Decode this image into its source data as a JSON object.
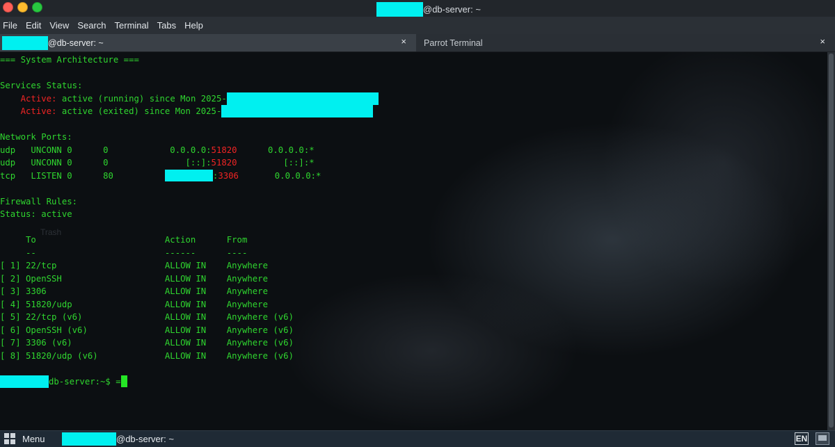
{
  "window": {
    "title_suffix": "@db-server: ~"
  },
  "menubar": [
    "File",
    "Edit",
    "View",
    "Search",
    "Terminal",
    "Tabs",
    "Help"
  ],
  "tabs": [
    {
      "label": "@db-server: ~",
      "close": "×"
    },
    {
      "label": "Parrot Terminal",
      "close": "×"
    }
  ],
  "terminal": {
    "lines": [
      {
        "parts": [
          {
            "t": "=== System Architecture ==="
          }
        ]
      },
      {
        "parts": [
          {
            "t": ""
          }
        ]
      },
      {
        "parts": [
          {
            "t": "Services Status:"
          }
        ]
      },
      {
        "parts": [
          {
            "t": "    "
          },
          {
            "t": "Active:",
            "c": "r"
          },
          {
            "t": " active (running) since Mon 2025-"
          }
        ],
        "redact": 218
      },
      {
        "parts": [
          {
            "t": "    "
          },
          {
            "t": "Active:",
            "c": "r"
          },
          {
            "t": " active (exited) since Mon 2025-"
          }
        ],
        "redact": 218
      },
      {
        "parts": [
          {
            "t": ""
          }
        ]
      },
      {
        "parts": [
          {
            "t": "Network Ports:"
          }
        ]
      },
      {
        "parts": [
          {
            "t": "udp   UNCONN 0      0            0.0.0.0:"
          },
          {
            "t": "51820",
            "c": "r"
          },
          {
            "t": "      0.0.0.0:*"
          }
        ]
      },
      {
        "parts": [
          {
            "t": "udp   UNCONN 0      0               [::]:"
          },
          {
            "t": "51820",
            "c": "r"
          },
          {
            "t": "         [::]:*"
          }
        ]
      },
      {
        "parts": [
          {
            "t": "tcp   LISTEN 0      80          "
          },
          {
            "t": ":"
          },
          {
            "t": "3306",
            "c": "r"
          },
          {
            "t": "       0.0.0.0:*"
          }
        ],
        "inline_redact": 69
      },
      {
        "parts": [
          {
            "t": ""
          }
        ]
      },
      {
        "parts": [
          {
            "t": "Firewall Rules:"
          }
        ]
      },
      {
        "parts": [
          {
            "t": "Status: active"
          }
        ]
      },
      {
        "parts": [
          {
            "t": ""
          }
        ]
      },
      {
        "parts": [
          {
            "t": "     To                         Action      From"
          }
        ]
      },
      {
        "parts": [
          {
            "t": "     --                         ------      ----"
          }
        ]
      },
      {
        "parts": [
          {
            "t": "[ 1] 22/tcp                     ALLOW IN    Anywhere"
          }
        ]
      },
      {
        "parts": [
          {
            "t": "[ 2] OpenSSH                    ALLOW IN    Anywhere"
          }
        ]
      },
      {
        "parts": [
          {
            "t": "[ 3] 3306                       ALLOW IN    Anywhere"
          }
        ]
      },
      {
        "parts": [
          {
            "t": "[ 4] 51820/udp                  ALLOW IN    Anywhere"
          }
        ]
      },
      {
        "parts": [
          {
            "t": "[ 5] 22/tcp (v6)                ALLOW IN    Anywhere (v6)"
          }
        ]
      },
      {
        "parts": [
          {
            "t": "[ 6] OpenSSH (v6)               ALLOW IN    Anywhere (v6)"
          }
        ]
      },
      {
        "parts": [
          {
            "t": "[ 7] 3306 (v6)                  ALLOW IN    Anywhere (v6)"
          }
        ]
      },
      {
        "parts": [
          {
            "t": "[ 8] 51820/udp (v6)             ALLOW IN    Anywhere (v6)"
          }
        ]
      },
      {
        "parts": [
          {
            "t": ""
          }
        ]
      },
      {
        "parts": [
          {
            "t": "db-server:~$ "
          },
          {
            "t": "="
          }
        ],
        "prompt": true
      }
    ],
    "desktop_ghost_labels": [
      "Trash"
    ]
  },
  "taskbar": {
    "menu_label": "Menu",
    "window_label": "@db-server: ~",
    "tray_keyboard": "EN"
  },
  "colors": {
    "redaction": "#00f0f0",
    "text_green": "#2fd62f",
    "text_red": "#f02424"
  }
}
